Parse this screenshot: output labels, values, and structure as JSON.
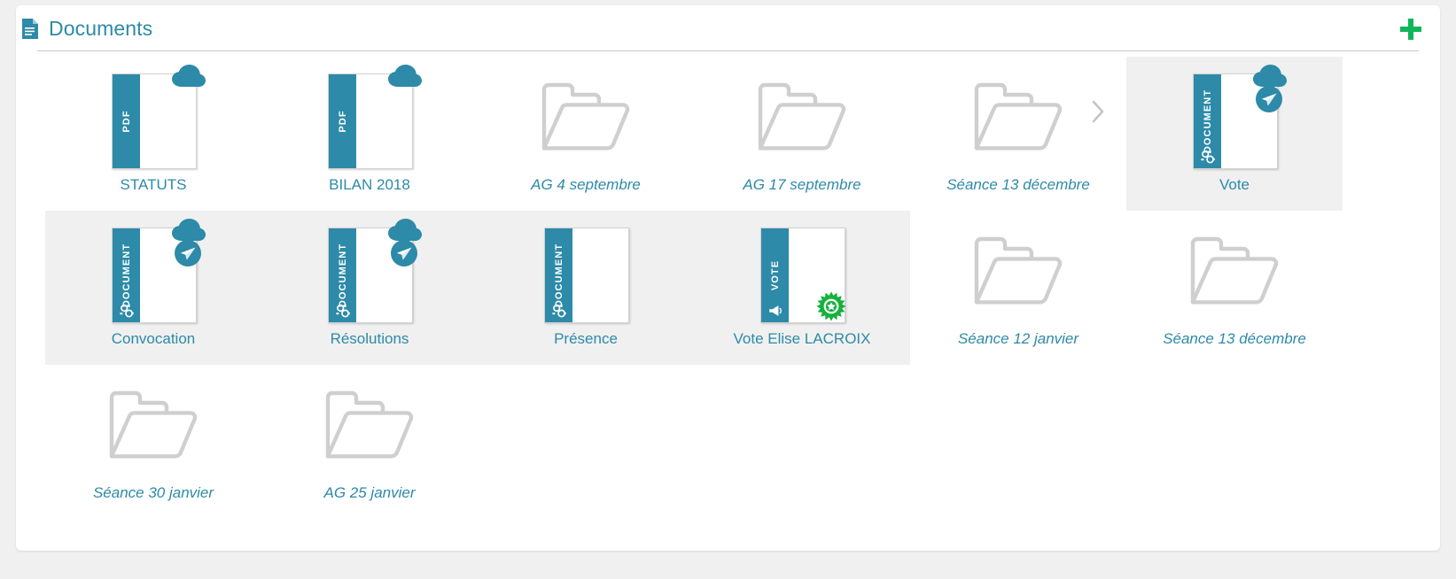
{
  "header": {
    "title": "Documents",
    "icon": "document-icon",
    "add_button": {
      "icon": "plus-icon",
      "color": "#10b65a"
    }
  },
  "colors": {
    "accent_teal": "#2d8aa8",
    "add_green": "#10b65a",
    "stamp_green": "#13b23c",
    "selected_bg": "#f0f0f0",
    "folder_outline": "#cfcfcf"
  },
  "items": [
    {
      "label": "STATUTS",
      "type": "file",
      "stripe_text": "PDF",
      "stripe_glyph": "none",
      "badges": [
        "cloud-icon"
      ],
      "selected": false,
      "chevron": false
    },
    {
      "label": "BILAN 2018",
      "type": "file",
      "stripe_text": "PDF",
      "stripe_glyph": "none",
      "badges": [
        "cloud-icon"
      ],
      "selected": false,
      "chevron": false
    },
    {
      "label": "AG 4 septembre",
      "type": "folder",
      "stripe_text": "",
      "stripe_glyph": "none",
      "badges": [],
      "selected": false,
      "chevron": false
    },
    {
      "label": "AG 17 septembre",
      "type": "folder",
      "stripe_text": "",
      "stripe_glyph": "none",
      "badges": [],
      "selected": false,
      "chevron": false
    },
    {
      "label": "Séance 13 décembre",
      "type": "folder",
      "stripe_text": "",
      "stripe_glyph": "none",
      "badges": [],
      "selected": false,
      "chevron": true
    },
    {
      "label": "Vote",
      "type": "file",
      "stripe_text": "DOCUMENT",
      "stripe_glyph": "gear-icon",
      "badges": [
        "cloud-icon",
        "send-icon"
      ],
      "selected": true,
      "chevron": false
    },
    {
      "label": "Convocation",
      "type": "file",
      "stripe_text": "DOCUMENT",
      "stripe_glyph": "gear-icon",
      "badges": [
        "cloud-icon",
        "send-icon"
      ],
      "selected": true,
      "chevron": false
    },
    {
      "label": "Résolutions",
      "type": "file",
      "stripe_text": "DOCUMENT",
      "stripe_glyph": "gear-icon",
      "badges": [
        "cloud-icon",
        "send-icon"
      ],
      "selected": true,
      "chevron": false
    },
    {
      "label": "Présence",
      "type": "file",
      "stripe_text": "DOCUMENT",
      "stripe_glyph": "gear-icon",
      "badges": [],
      "selected": true,
      "chevron": false
    },
    {
      "label": "Vote Elise LACROIX",
      "type": "file",
      "stripe_text": "VOTE",
      "stripe_glyph": "megaphone-icon",
      "badges": [
        "stamp-icon"
      ],
      "selected": true,
      "chevron": false
    },
    {
      "label": "Séance 12 janvier",
      "type": "folder",
      "stripe_text": "",
      "stripe_glyph": "none",
      "badges": [],
      "selected": false,
      "chevron": false
    },
    {
      "label": "Séance 13 décembre",
      "type": "folder",
      "stripe_text": "",
      "stripe_glyph": "none",
      "badges": [],
      "selected": false,
      "chevron": false
    },
    {
      "label": "Séance 30 janvier",
      "type": "folder",
      "stripe_text": "",
      "stripe_glyph": "none",
      "badges": [],
      "selected": false,
      "chevron": false
    },
    {
      "label": "AG 25 janvier",
      "type": "folder",
      "stripe_text": "",
      "stripe_glyph": "none",
      "badges": [],
      "selected": false,
      "chevron": false
    }
  ]
}
